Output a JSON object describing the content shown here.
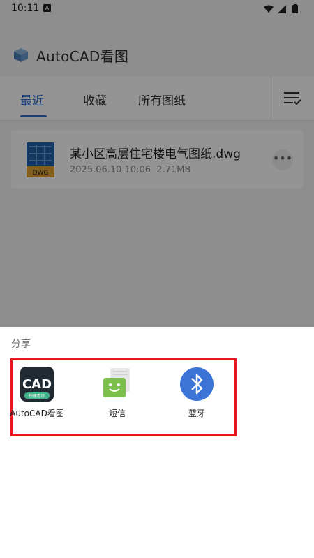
{
  "status_bar": {
    "time": "10:11",
    "notification_badge": "A"
  },
  "app": {
    "title": "AutoCAD看图"
  },
  "tabs": [
    {
      "label": "最近",
      "active": true
    },
    {
      "label": "收藏",
      "active": false
    },
    {
      "label": "所有图纸",
      "active": false
    }
  ],
  "file": {
    "name": "某小区高层住宅楼电气图纸.dwg",
    "date": "2025.06.10 10:06",
    "size": "2.71MB",
    "type_badge": "DWG"
  },
  "share_sheet": {
    "title": "分享",
    "targets": [
      {
        "label": "AutoCAD看图",
        "icon": "cad-app-icon",
        "icon_text": "CAD",
        "icon_subtext": "快速看图"
      },
      {
        "label": "短信",
        "icon": "sms-icon"
      },
      {
        "label": "蓝牙",
        "icon": "bluetooth-icon"
      }
    ]
  },
  "colors": {
    "accent": "#2a6fdb",
    "highlight": "#e8151b",
    "bluetooth": "#3b73d6",
    "sms": "#7cc04b"
  }
}
